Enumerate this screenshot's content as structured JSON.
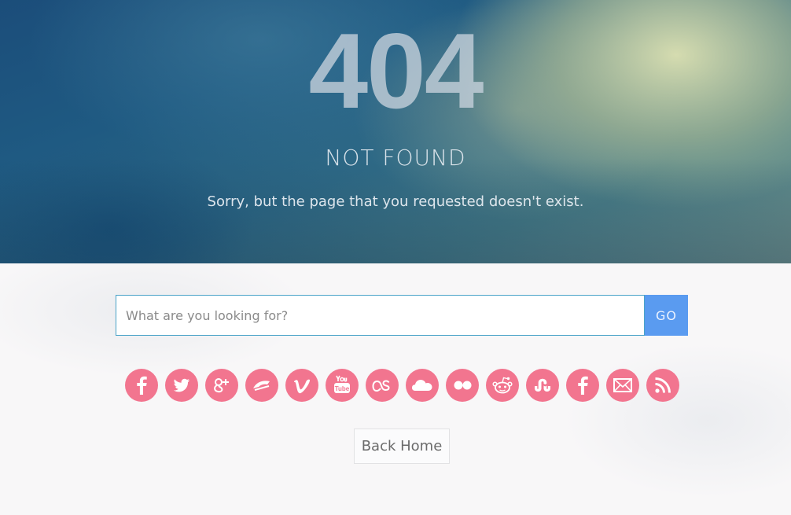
{
  "hero": {
    "code": "404",
    "title": "NOT FOUND",
    "message": "Sorry, but the page that you requested doesn't exist."
  },
  "search": {
    "placeholder": "What are you looking for?",
    "value": "",
    "button_label": "GO"
  },
  "social_links": [
    {
      "name": "facebook-icon"
    },
    {
      "name": "twitter-icon"
    },
    {
      "name": "google-plus-icon"
    },
    {
      "name": "deviantart-icon"
    },
    {
      "name": "vimeo-icon"
    },
    {
      "name": "youtube-icon"
    },
    {
      "name": "lastfm-icon"
    },
    {
      "name": "soundcloud-icon"
    },
    {
      "name": "flickr-icon"
    },
    {
      "name": "reddit-icon"
    },
    {
      "name": "stumbleupon-icon"
    },
    {
      "name": "facebook-icon"
    },
    {
      "name": "email-icon"
    },
    {
      "name": "rss-icon"
    }
  ],
  "back_home_label": "Back Home",
  "colors": {
    "social_icon_bg": "#f2758f",
    "go_button": "#5a9bf0",
    "input_border": "#4aa3c8"
  }
}
